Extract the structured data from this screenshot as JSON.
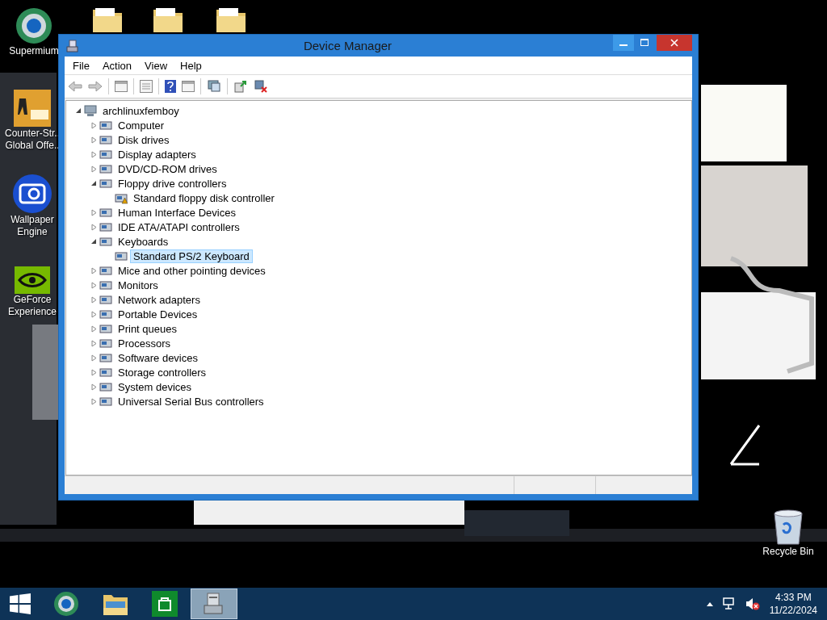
{
  "desktop_icons": [
    {
      "kind": "folder"
    },
    {
      "kind": "folder"
    },
    {
      "kind": "folder"
    },
    {
      "kind": "browser",
      "lines": [
        "Supermium"
      ]
    },
    {
      "kind": "game",
      "lines": [
        "Counter-Str..",
        "Global Offe.."
      ]
    },
    {
      "kind": "gear",
      "lines": [
        "Wallpaper",
        "Engine"
      ]
    },
    {
      "kind": "nvidia",
      "lines": [
        "GeForce",
        "Experience"
      ]
    },
    {
      "kind": "recycle",
      "lines": [
        "Recycle Bin"
      ]
    }
  ],
  "window": {
    "title": "Device Manager",
    "menu": [
      "File",
      "Action",
      "View",
      "Help"
    ],
    "tree": {
      "label": "archlinuxfemboy",
      "expanded": true,
      "selected": false,
      "children": [
        {
          "label": "Computer",
          "expanded": false,
          "selected": false
        },
        {
          "label": "Disk drives",
          "expanded": false,
          "selected": false
        },
        {
          "label": "Display adapters",
          "expanded": false,
          "selected": false
        },
        {
          "label": "DVD/CD-ROM drives",
          "expanded": false,
          "selected": false
        },
        {
          "label": "Floppy drive controllers",
          "expanded": true,
          "selected": false,
          "children": [
            {
              "label": "Standard floppy disk controller",
              "selected": false,
              "warning": true
            }
          ]
        },
        {
          "label": "Human Interface Devices",
          "expanded": false,
          "selected": false
        },
        {
          "label": "IDE ATA/ATAPI controllers",
          "expanded": false,
          "selected": false
        },
        {
          "label": "Keyboards",
          "expanded": true,
          "selected": false,
          "children": [
            {
              "label": "Standard PS/2 Keyboard",
              "selected": true,
              "warning": false
            }
          ]
        },
        {
          "label": "Mice and other pointing devices",
          "expanded": false,
          "selected": false
        },
        {
          "label": "Monitors",
          "expanded": false,
          "selected": false
        },
        {
          "label": "Network adapters",
          "expanded": false,
          "selected": false
        },
        {
          "label": "Portable Devices",
          "expanded": false,
          "selected": false
        },
        {
          "label": "Print queues",
          "expanded": false,
          "selected": false
        },
        {
          "label": "Processors",
          "expanded": false,
          "selected": false
        },
        {
          "label": "Software devices",
          "expanded": false,
          "selected": false
        },
        {
          "label": "Storage controllers",
          "expanded": false,
          "selected": false
        },
        {
          "label": "System devices",
          "expanded": false,
          "selected": false
        },
        {
          "label": "Universal Serial Bus controllers",
          "expanded": false,
          "selected": false
        }
      ]
    }
  },
  "taskbar": {
    "apps": [
      {
        "kind": "browser",
        "selected": false
      },
      {
        "kind": "explorer",
        "selected": false
      },
      {
        "kind": "store",
        "selected": false
      },
      {
        "kind": "devmgr",
        "selected": true
      }
    ],
    "time": "4:33 PM",
    "date": "11/22/2024",
    "volume_muted": true
  }
}
